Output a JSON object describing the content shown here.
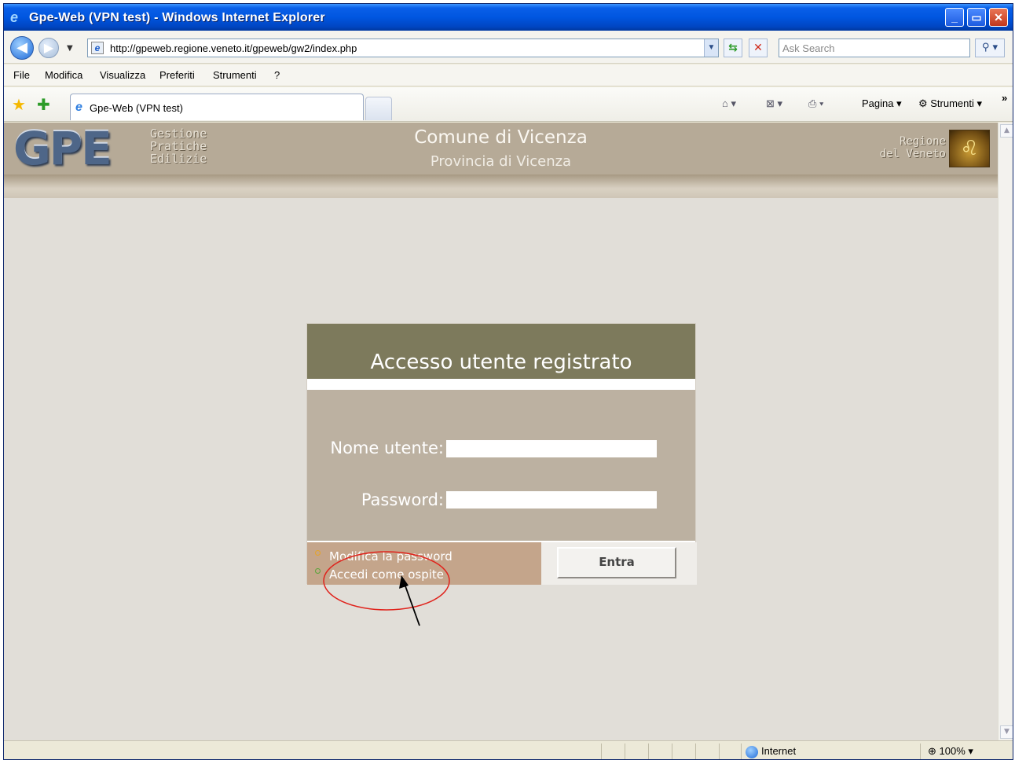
{
  "window": {
    "title": "Gpe-Web (VPN test) - Windows Internet Explorer",
    "min": "_",
    "max": "▭",
    "close": "✕"
  },
  "nav": {
    "back": "◀",
    "forward": "▶",
    "dropdown": "▼",
    "url": "http://gpeweb.regione.veneto.it/gpeweb/gw2/index.php",
    "refresh": "⇆",
    "stop": "✕",
    "search_placeholder": "Ask Search",
    "search_btn": "⚲ ▾"
  },
  "menu": [
    "File",
    "Modifica",
    "Visualizza",
    "Preferiti",
    "Strumenti",
    "?"
  ],
  "tabbar": {
    "tab_title": "Gpe-Web (VPN test)",
    "home": "⌂ ▾",
    "feeds": "⊠ ▾",
    "print": "⎙ ▾",
    "pagina": "Pagina ▾",
    "strumenti": "⚙ Strumenti ▾",
    "chevron": "»"
  },
  "header": {
    "logo": "GPE",
    "logo_sub": [
      "Gestione",
      "Pratiche",
      "Edilizie"
    ],
    "comune": "Comune di Vicenza",
    "provincia": "Provincia di Vicenza",
    "regione": [
      "Regione",
      "del Veneto"
    ]
  },
  "login": {
    "heading": "Accesso utente registrato",
    "username_label": "Nome utente:",
    "password_label": "Password:",
    "username_value": "",
    "password_value": "",
    "links": [
      "Modifica la password",
      "Accedi come ospite"
    ],
    "submit": "Entra"
  },
  "status": {
    "zone": "Internet",
    "zoom": "100%",
    "zoom_drop": "▾"
  },
  "colors": {
    "header_bg": "#b6aa97",
    "panel_head": "#7d7a5c",
    "panel_body": "#bcb1a1",
    "panel_foot": "#c4a58b",
    "annotation": "#e0231c"
  }
}
